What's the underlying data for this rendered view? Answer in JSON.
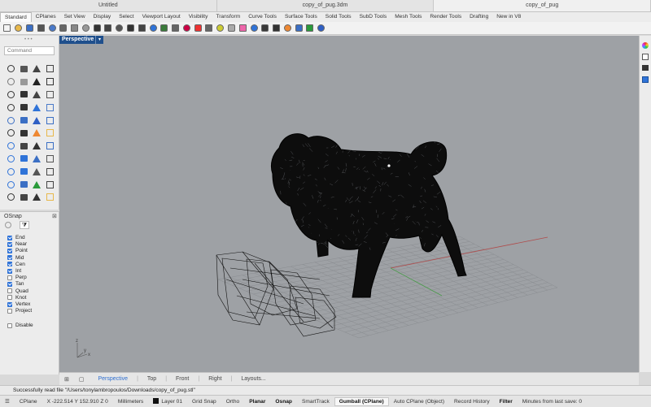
{
  "window_tabs": [
    "Untitled",
    "copy_of_pug.3dm",
    "copy_of_pug"
  ],
  "toolbar_tabs": [
    "Standard",
    "CPlanes",
    "Set View",
    "Display",
    "Select",
    "Viewport Layout",
    "Visibility",
    "Transform",
    "Curve Tools",
    "Surface Tools",
    "Solid Tools",
    "SubD Tools",
    "Mesh Tools",
    "Render Tools",
    "Drafting",
    "New in V8"
  ],
  "toolbar_icons": [
    "new-file-icon",
    "open-file-icon",
    "save-icon",
    "print-icon",
    "import-icon",
    "cut-icon",
    "copy-icon",
    "paste-icon",
    "undo-icon",
    "pan-icon",
    "rotate-view-icon",
    "zoom-icon",
    "zoom-window-icon",
    "zoom-extents-icon",
    "zoom-selected-icon",
    "grid-icon",
    "lock-icon",
    "layer-icon",
    "material-icon",
    "light-icon",
    "rectangle-icon",
    "color-wheel-icon",
    "sphere-icon",
    "render-icon",
    "camera-icon",
    "paint-icon",
    "curve-icon",
    "globe-icon",
    "help-icon"
  ],
  "command": {
    "placeholder": "Command"
  },
  "viewport": {
    "name": "Perspective",
    "axis_x": "x",
    "axis_y": "y",
    "axis_z": "z"
  },
  "osnap": {
    "title": "OSnap",
    "items": [
      {
        "label": "End",
        "checked": true
      },
      {
        "label": "Near",
        "checked": true
      },
      {
        "label": "Point",
        "checked": true
      },
      {
        "label": "Mid",
        "checked": true
      },
      {
        "label": "Cen",
        "checked": true
      },
      {
        "label": "Int",
        "checked": true
      },
      {
        "label": "Perp",
        "checked": false
      },
      {
        "label": "Tan",
        "checked": true
      },
      {
        "label": "Quad",
        "checked": false
      },
      {
        "label": "Knot",
        "checked": false
      },
      {
        "label": "Vertex",
        "checked": true
      },
      {
        "label": "Project",
        "checked": false
      }
    ],
    "disable_label": "Disable"
  },
  "view_tabs": [
    "Perspective",
    "Top",
    "Front",
    "Right",
    "Layouts..."
  ],
  "status_message": "Successfully read file \"/Users/tonylambropoulos/Downloads/copy_of_pug.stl\"",
  "statusbar": {
    "cplane": "CPlane",
    "coords": "X -222.514 Y 152.910 Z 0",
    "units": "Millimeters",
    "layer": "Layer 01",
    "grid_snap": "Grid Snap",
    "ortho": "Ortho",
    "planar": "Planar",
    "osnap": "Osnap",
    "smarttrack": "SmartTrack",
    "gumball": "Gumball (CPlane)",
    "auto_cplane": "Auto CPlane (Object)",
    "record_history": "Record History",
    "filter": "Filter",
    "last_save": "Minutes from last save: 0"
  },
  "colors": {
    "viewport_bg": "#9ea1a5",
    "accent": "#2f73d8",
    "viewport_label_bg": "#1f4f8c"
  }
}
